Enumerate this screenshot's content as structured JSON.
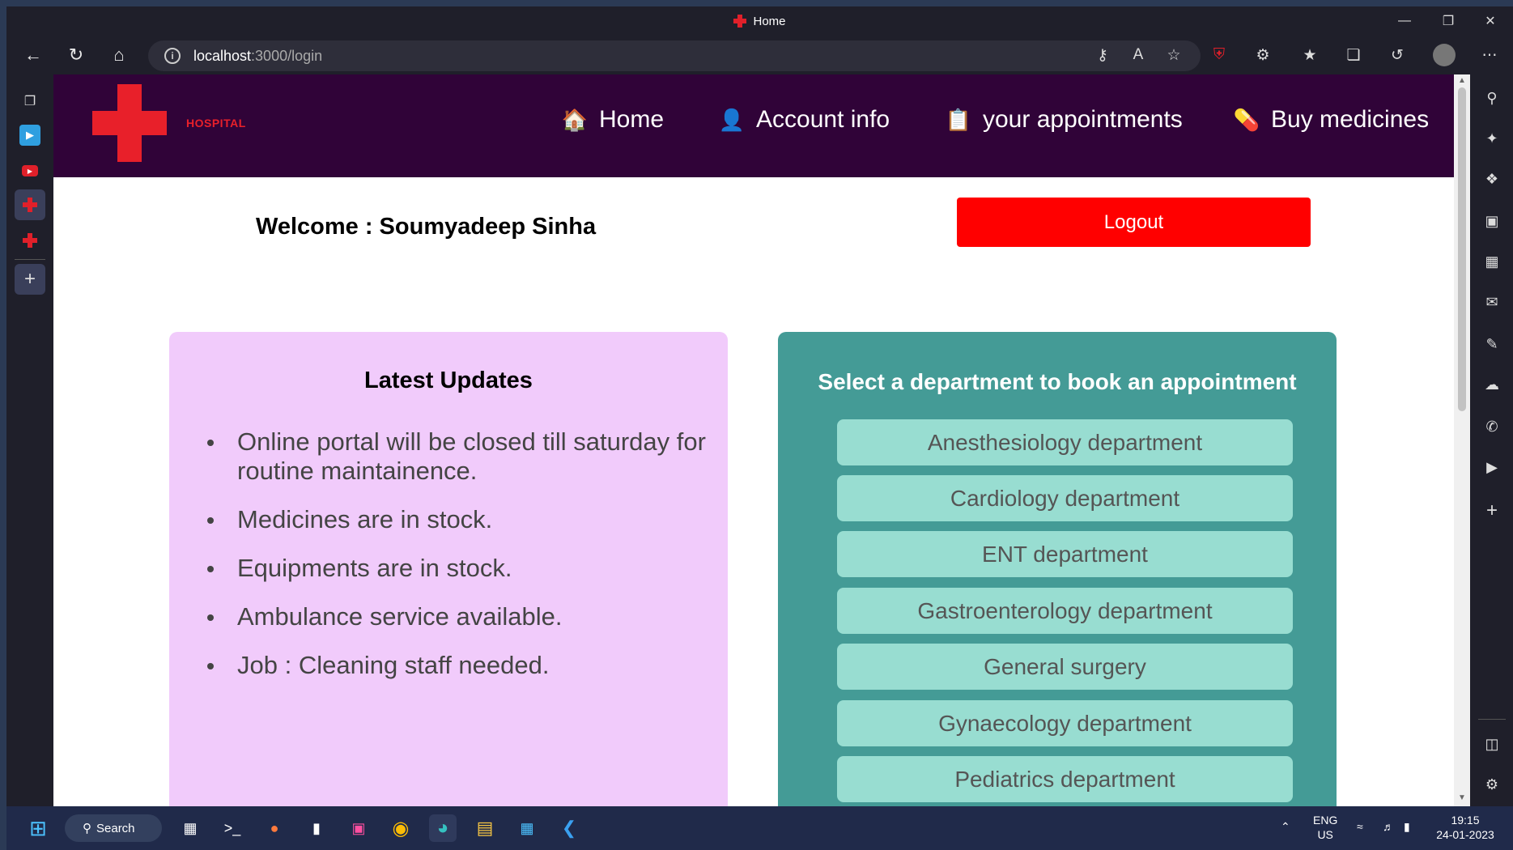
{
  "window": {
    "title": "Home"
  },
  "browser": {
    "url_host": "localhost",
    "url_path": ":3000/login"
  },
  "site": {
    "logo_text": "HOSPITAL",
    "brand_color": "#e8202a",
    "header_color": "#300338",
    "nav": [
      {
        "label": "Home",
        "icon": "house-icon"
      },
      {
        "label": "Account info",
        "icon": "user-icon"
      },
      {
        "label": "your appointments",
        "icon": "clipboard-icon"
      },
      {
        "label": "Buy medicines",
        "icon": "pill-icon"
      }
    ],
    "welcome": "Welcome : Soumyadeep Sinha",
    "logout_label": "Logout"
  },
  "updates": {
    "title": "Latest Updates",
    "items": [
      "Online portal will be closed till saturday for routine maintainence.",
      "Medicines are in stock.",
      "Equipments are in stock.",
      "Ambulance service available.",
      "Job : Cleaning staff needed."
    ]
  },
  "departments": {
    "title": "Select a department to book an appointment",
    "items": [
      "Anesthesiology department",
      "Cardiology department",
      "ENT department",
      "Gastroenterology department",
      "General surgery",
      "Gynaecology department",
      "Pediatrics department"
    ]
  },
  "taskbar": {
    "search_label": "Search",
    "lang_top": "ENG",
    "lang_bottom": "US",
    "time": "19:15",
    "date": "24-01-2023"
  }
}
